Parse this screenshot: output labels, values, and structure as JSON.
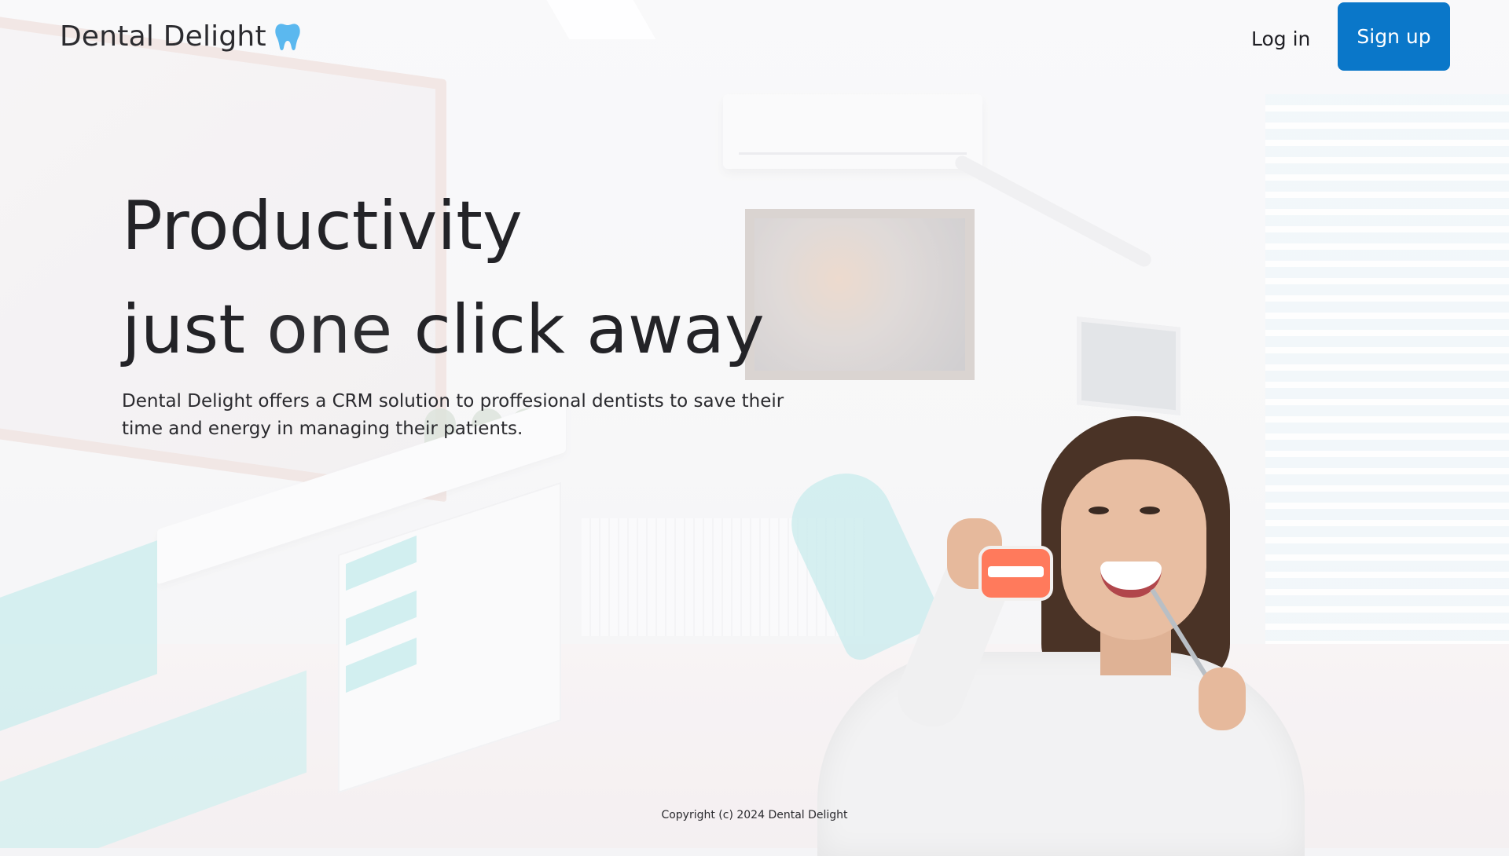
{
  "header": {
    "brand_name": "Dental Delight",
    "brand_icon": "tooth-icon",
    "login_label": "Log in",
    "signup_label": "Sign up"
  },
  "hero": {
    "title_line1": "Productivity",
    "title_line2_part1": "just",
    "title_line2_part2": "one",
    "title_line2_part3": "click away",
    "description": "Dental Delight offers a CRM solution to proffesional dentists to save their time and energy in managing their patients."
  },
  "footer": {
    "copyright": "Copyright (c) 2024 Dental Delight"
  },
  "colors": {
    "accent": "#0a77c9",
    "tooth_icon": "#5bb8ef",
    "text_dark": "#232327"
  }
}
